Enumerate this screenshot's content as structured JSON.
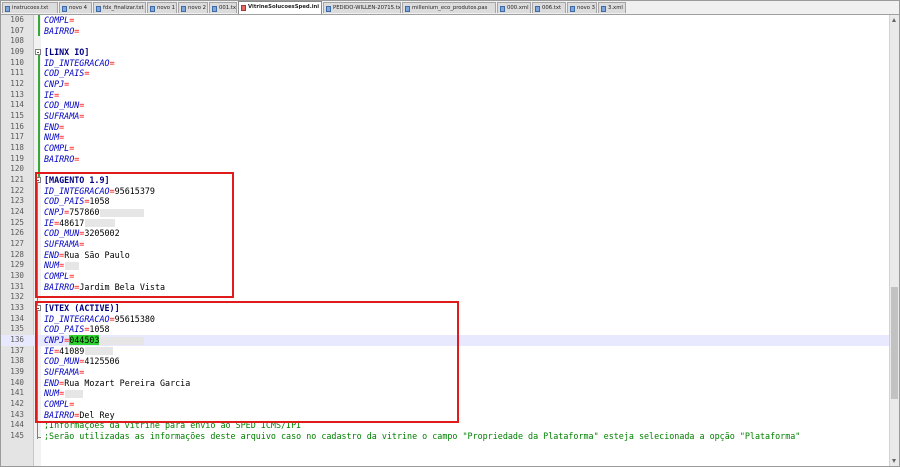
{
  "tabs": [
    {
      "label": "instrucoes.txt",
      "active": false
    },
    {
      "label": "novo 4",
      "active": false
    },
    {
      "label": "fdx_finalizar.txt",
      "active": false
    },
    {
      "label": "novo 1",
      "active": false
    },
    {
      "label": "novo 2",
      "active": false
    },
    {
      "label": "001.txt",
      "active": false
    },
    {
      "label": "VitrineSolucoesSped.ini",
      "active": true
    },
    {
      "label": "PEDIDO-WILLEN-20715.txt",
      "active": false
    },
    {
      "label": "millenium_eco_produtos.pas",
      "active": false
    },
    {
      "label": "000.xml",
      "active": false
    },
    {
      "label": "006.txt",
      "active": false
    },
    {
      "label": "novo 3",
      "active": false
    },
    {
      "label": "3.xml",
      "active": false
    }
  ],
  "lines": [
    {
      "n": "106",
      "parts": [
        {
          "t": "COMPL",
          "c": "key"
        },
        {
          "t": "=",
          "c": "eq"
        }
      ]
    },
    {
      "n": "107",
      "parts": [
        {
          "t": "BAIRRO",
          "c": "key"
        },
        {
          "t": "=",
          "c": "eq"
        }
      ]
    },
    {
      "n": "108",
      "parts": []
    },
    {
      "n": "109",
      "parts": [
        {
          "t": "[",
          "c": "br"
        },
        {
          "t": "LINX IO",
          "c": "sec"
        },
        {
          "t": "]",
          "c": "br"
        }
      ]
    },
    {
      "n": "110",
      "parts": [
        {
          "t": "ID_INTEGRACAO",
          "c": "key"
        },
        {
          "t": "=",
          "c": "eq"
        }
      ]
    },
    {
      "n": "111",
      "parts": [
        {
          "t": "COD_PAIS",
          "c": "key"
        },
        {
          "t": "=",
          "c": "eq"
        }
      ]
    },
    {
      "n": "112",
      "parts": [
        {
          "t": "CNPJ",
          "c": "key"
        },
        {
          "t": "=",
          "c": "eq"
        }
      ]
    },
    {
      "n": "113",
      "parts": [
        {
          "t": "IE",
          "c": "key"
        },
        {
          "t": "=",
          "c": "eq"
        }
      ]
    },
    {
      "n": "114",
      "parts": [
        {
          "t": "COD_MUN",
          "c": "key"
        },
        {
          "t": "=",
          "c": "eq"
        }
      ]
    },
    {
      "n": "115",
      "parts": [
        {
          "t": "SUFRAMA",
          "c": "key"
        },
        {
          "t": "=",
          "c": "eq"
        }
      ]
    },
    {
      "n": "116",
      "parts": [
        {
          "t": "END",
          "c": "key"
        },
        {
          "t": "=",
          "c": "eq"
        }
      ]
    },
    {
      "n": "117",
      "parts": [
        {
          "t": "NUM",
          "c": "key"
        },
        {
          "t": "=",
          "c": "eq"
        }
      ]
    },
    {
      "n": "118",
      "parts": [
        {
          "t": "COMPL",
          "c": "key"
        },
        {
          "t": "=",
          "c": "eq"
        }
      ]
    },
    {
      "n": "119",
      "parts": [
        {
          "t": "BAIRRO",
          "c": "key"
        },
        {
          "t": "=",
          "c": "eq"
        }
      ]
    },
    {
      "n": "120",
      "parts": []
    },
    {
      "n": "121",
      "parts": [
        {
          "t": "[",
          "c": "br"
        },
        {
          "t": "MAGENTO 1.9",
          "c": "sec"
        },
        {
          "t": "]",
          "c": "br"
        }
      ]
    },
    {
      "n": "122",
      "parts": [
        {
          "t": "ID_INTEGRACAO",
          "c": "key"
        },
        {
          "t": "=",
          "c": "eq"
        },
        {
          "t": "95615379",
          "c": "val"
        }
      ]
    },
    {
      "n": "123",
      "parts": [
        {
          "t": "COD_PAIS",
          "c": "key"
        },
        {
          "t": "=",
          "c": "eq"
        },
        {
          "t": "1058",
          "c": "val"
        }
      ]
    },
    {
      "n": "124",
      "parts": [
        {
          "t": "CNPJ",
          "c": "key"
        },
        {
          "t": "=",
          "c": "eq"
        },
        {
          "t": "757860",
          "c": "val"
        },
        {
          "t": "",
          "c": "blur",
          "w": 44
        }
      ]
    },
    {
      "n": "125",
      "parts": [
        {
          "t": "IE",
          "c": "key"
        },
        {
          "t": "=",
          "c": "eq"
        },
        {
          "t": "48617",
          "c": "val"
        },
        {
          "t": "",
          "c": "blur",
          "w": 30
        }
      ]
    },
    {
      "n": "126",
      "parts": [
        {
          "t": "COD_MUN",
          "c": "key"
        },
        {
          "t": "=",
          "c": "eq"
        },
        {
          "t": "3205002",
          "c": "val"
        }
      ]
    },
    {
      "n": "127",
      "parts": [
        {
          "t": "SUFRAMA",
          "c": "key"
        },
        {
          "t": "=",
          "c": "eq"
        }
      ]
    },
    {
      "n": "128",
      "parts": [
        {
          "t": "END",
          "c": "key"
        },
        {
          "t": "=",
          "c": "eq"
        },
        {
          "t": "Rua São Paulo",
          "c": "val"
        }
      ]
    },
    {
      "n": "129",
      "parts": [
        {
          "t": "NUM",
          "c": "key"
        },
        {
          "t": "=",
          "c": "eq"
        },
        {
          "t": "",
          "c": "blur",
          "w": 14
        }
      ]
    },
    {
      "n": "130",
      "parts": [
        {
          "t": "COMPL",
          "c": "key"
        },
        {
          "t": "=",
          "c": "eq"
        }
      ]
    },
    {
      "n": "131",
      "parts": [
        {
          "t": "BAIRRO",
          "c": "key"
        },
        {
          "t": "=",
          "c": "eq"
        },
        {
          "t": "Jardim Bela Vista",
          "c": "val"
        }
      ]
    },
    {
      "n": "132",
      "parts": []
    },
    {
      "n": "133",
      "parts": [
        {
          "t": "[",
          "c": "br"
        },
        {
          "t": "VTEX (ACTIVE)",
          "c": "sec"
        },
        {
          "t": "]",
          "c": "br"
        }
      ]
    },
    {
      "n": "134",
      "parts": [
        {
          "t": "ID_INTEGRACAO",
          "c": "key"
        },
        {
          "t": "=",
          "c": "eq"
        },
        {
          "t": "95615380",
          "c": "val"
        }
      ]
    },
    {
      "n": "135",
      "parts": [
        {
          "t": "COD_PAIS",
          "c": "key"
        },
        {
          "t": "=",
          "c": "eq"
        },
        {
          "t": "1058",
          "c": "val"
        }
      ]
    },
    {
      "n": "136",
      "parts": [
        {
          "t": "CNPJ",
          "c": "key"
        },
        {
          "t": "=",
          "c": "eq"
        },
        {
          "t": "044503",
          "c": "sel"
        },
        {
          "t": "",
          "c": "blur",
          "w": 44
        }
      ],
      "current": true
    },
    {
      "n": "137",
      "parts": [
        {
          "t": "IE",
          "c": "key"
        },
        {
          "t": "=",
          "c": "eq"
        },
        {
          "t": "41089",
          "c": "val"
        },
        {
          "t": "",
          "c": "blur",
          "w": 28
        }
      ]
    },
    {
      "n": "138",
      "parts": [
        {
          "t": "COD_MUN",
          "c": "key"
        },
        {
          "t": "=",
          "c": "eq"
        },
        {
          "t": "4125506",
          "c": "val"
        }
      ]
    },
    {
      "n": "139",
      "parts": [
        {
          "t": "SUFRAMA",
          "c": "key"
        },
        {
          "t": "=",
          "c": "eq"
        }
      ]
    },
    {
      "n": "140",
      "parts": [
        {
          "t": "END",
          "c": "key"
        },
        {
          "t": "=",
          "c": "eq"
        },
        {
          "t": "Rua Mozart Pereira Garcia",
          "c": "val"
        }
      ]
    },
    {
      "n": "141",
      "parts": [
        {
          "t": "NUM",
          "c": "key"
        },
        {
          "t": "=",
          "c": "eq"
        },
        {
          "t": "",
          "c": "blur",
          "w": 18
        }
      ]
    },
    {
      "n": "142",
      "parts": [
        {
          "t": "COMPL",
          "c": "key"
        },
        {
          "t": "=",
          "c": "eq"
        }
      ]
    },
    {
      "n": "143",
      "parts": [
        {
          "t": "BAIRRO",
          "c": "key"
        },
        {
          "t": "=",
          "c": "eq"
        },
        {
          "t": "Del Rey",
          "c": "val"
        }
      ]
    },
    {
      "n": "144",
      "parts": [
        {
          "t": ";Informações da vitrine para envio ao SPED ICMS/IPI",
          "c": "cmt"
        }
      ]
    },
    {
      "n": "145",
      "parts": [
        {
          "t": ";Serão utilizadas as informações deste arquivo caso no cadastro da vitrine o campo \"Propriedade da Plataforma\" esteja selecionada a opção \"Plataforma\"",
          "c": "cmt"
        }
      ]
    }
  ],
  "colors": {
    "highlight_box": "#e01b1b",
    "selection": "#2fd02f",
    "section": "#000080",
    "key": "#0000c0",
    "equals": "#ff0000",
    "comment": "#008000"
  }
}
